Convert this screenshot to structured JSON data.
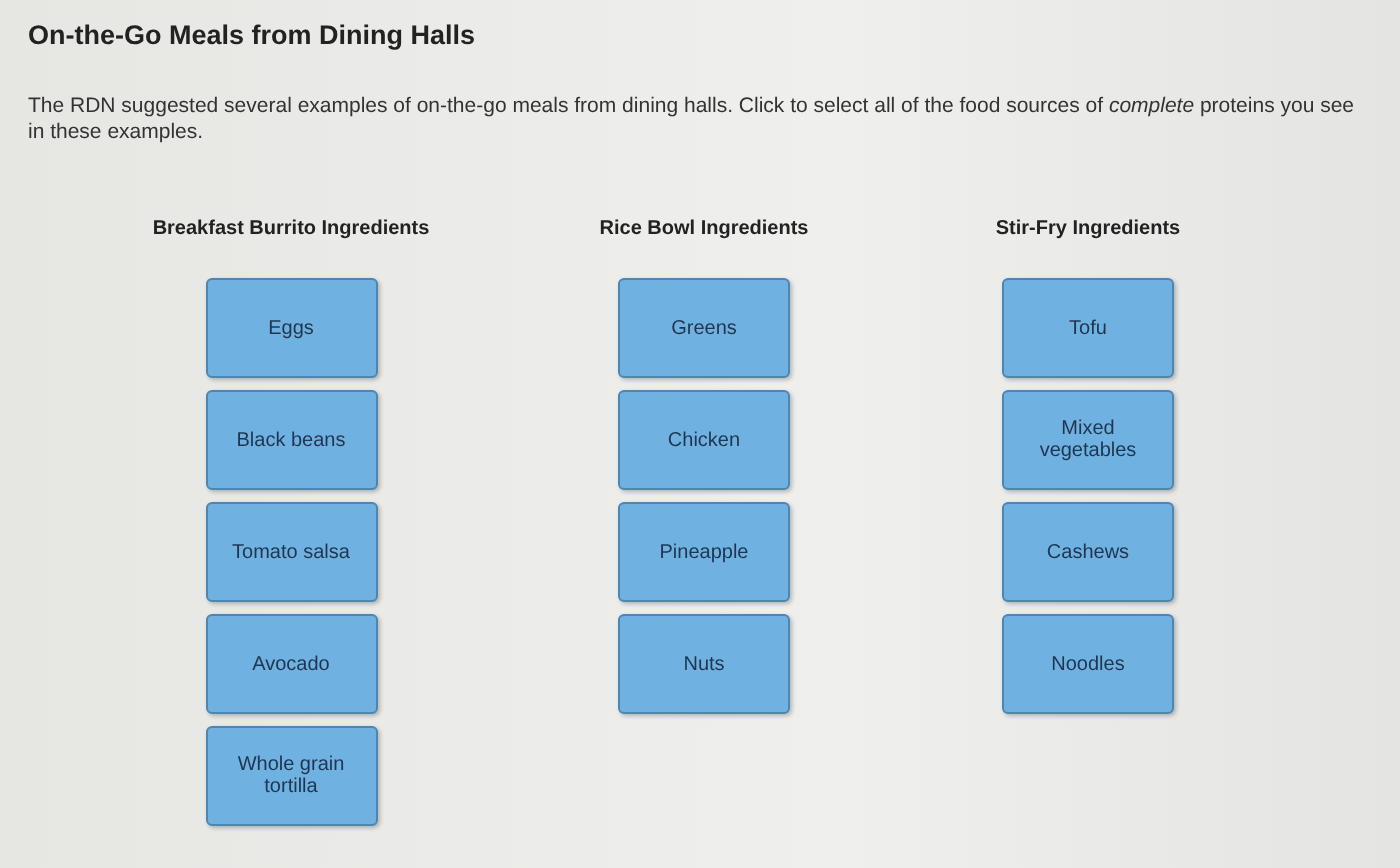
{
  "title": "On-the-Go Meals from Dining Halls",
  "instructions": "The RDN suggested several examples of on-the-go meals from dining halls. Click to select all of the food sources of *complete* proteins you see in these examples.",
  "columns": [
    {
      "heading": "Breakfast Burrito Ingredients",
      "items": [
        "Eggs",
        "Black beans",
        "Tomato salsa",
        "Avocado",
        "Whole grain tortilla"
      ]
    },
    {
      "heading": "Rice Bowl Ingredients",
      "items": [
        "Greens",
        "Chicken",
        "Pineapple",
        "Nuts"
      ]
    },
    {
      "heading": "Stir-Fry Ingredients",
      "items": [
        "Tofu",
        "Mixed vegetables",
        "Cashews",
        "Noodles"
      ]
    }
  ]
}
